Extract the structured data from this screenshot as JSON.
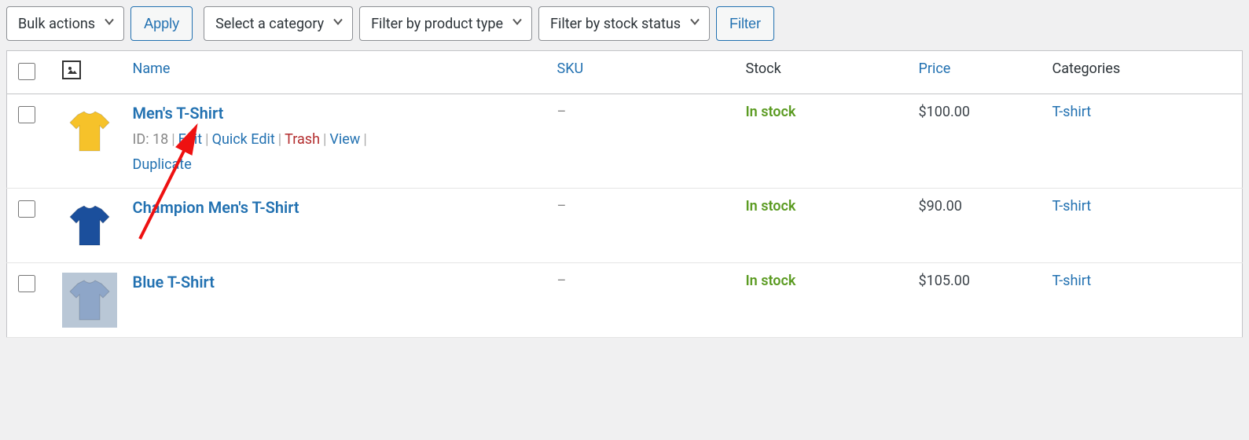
{
  "toolbar": {
    "bulk_actions": "Bulk actions",
    "apply": "Apply",
    "select_category": "Select a category",
    "filter_product_type": "Filter by product type",
    "filter_stock_status": "Filter by stock status",
    "filter": "Filter"
  },
  "columns": {
    "name": "Name",
    "sku": "SKU",
    "stock": "Stock",
    "price": "Price",
    "categories": "Categories"
  },
  "row_action_labels": {
    "id_prefix": "ID: ",
    "edit": "Edit",
    "quick_edit": "Quick Edit",
    "trash": "Trash",
    "view": "View",
    "duplicate": "Duplicate"
  },
  "products": [
    {
      "id": "18",
      "name": "Men's T-Shirt",
      "sku": "–",
      "stock": "In stock",
      "price": "$100.00",
      "category": "T-shirt",
      "thumb_color": "#f6c22a",
      "show_actions": true
    },
    {
      "id": "",
      "name": "Champion Men's T-Shirt",
      "sku": "–",
      "stock": "In stock",
      "price": "$90.00",
      "category": "T-shirt",
      "thumb_color": "#1b4f9c",
      "show_actions": false
    },
    {
      "id": "",
      "name": "Blue T-Shirt",
      "sku": "–",
      "stock": "In stock",
      "price": "$105.00",
      "category": "T-shirt",
      "thumb_color": "#8ea6c8",
      "show_actions": false
    }
  ]
}
